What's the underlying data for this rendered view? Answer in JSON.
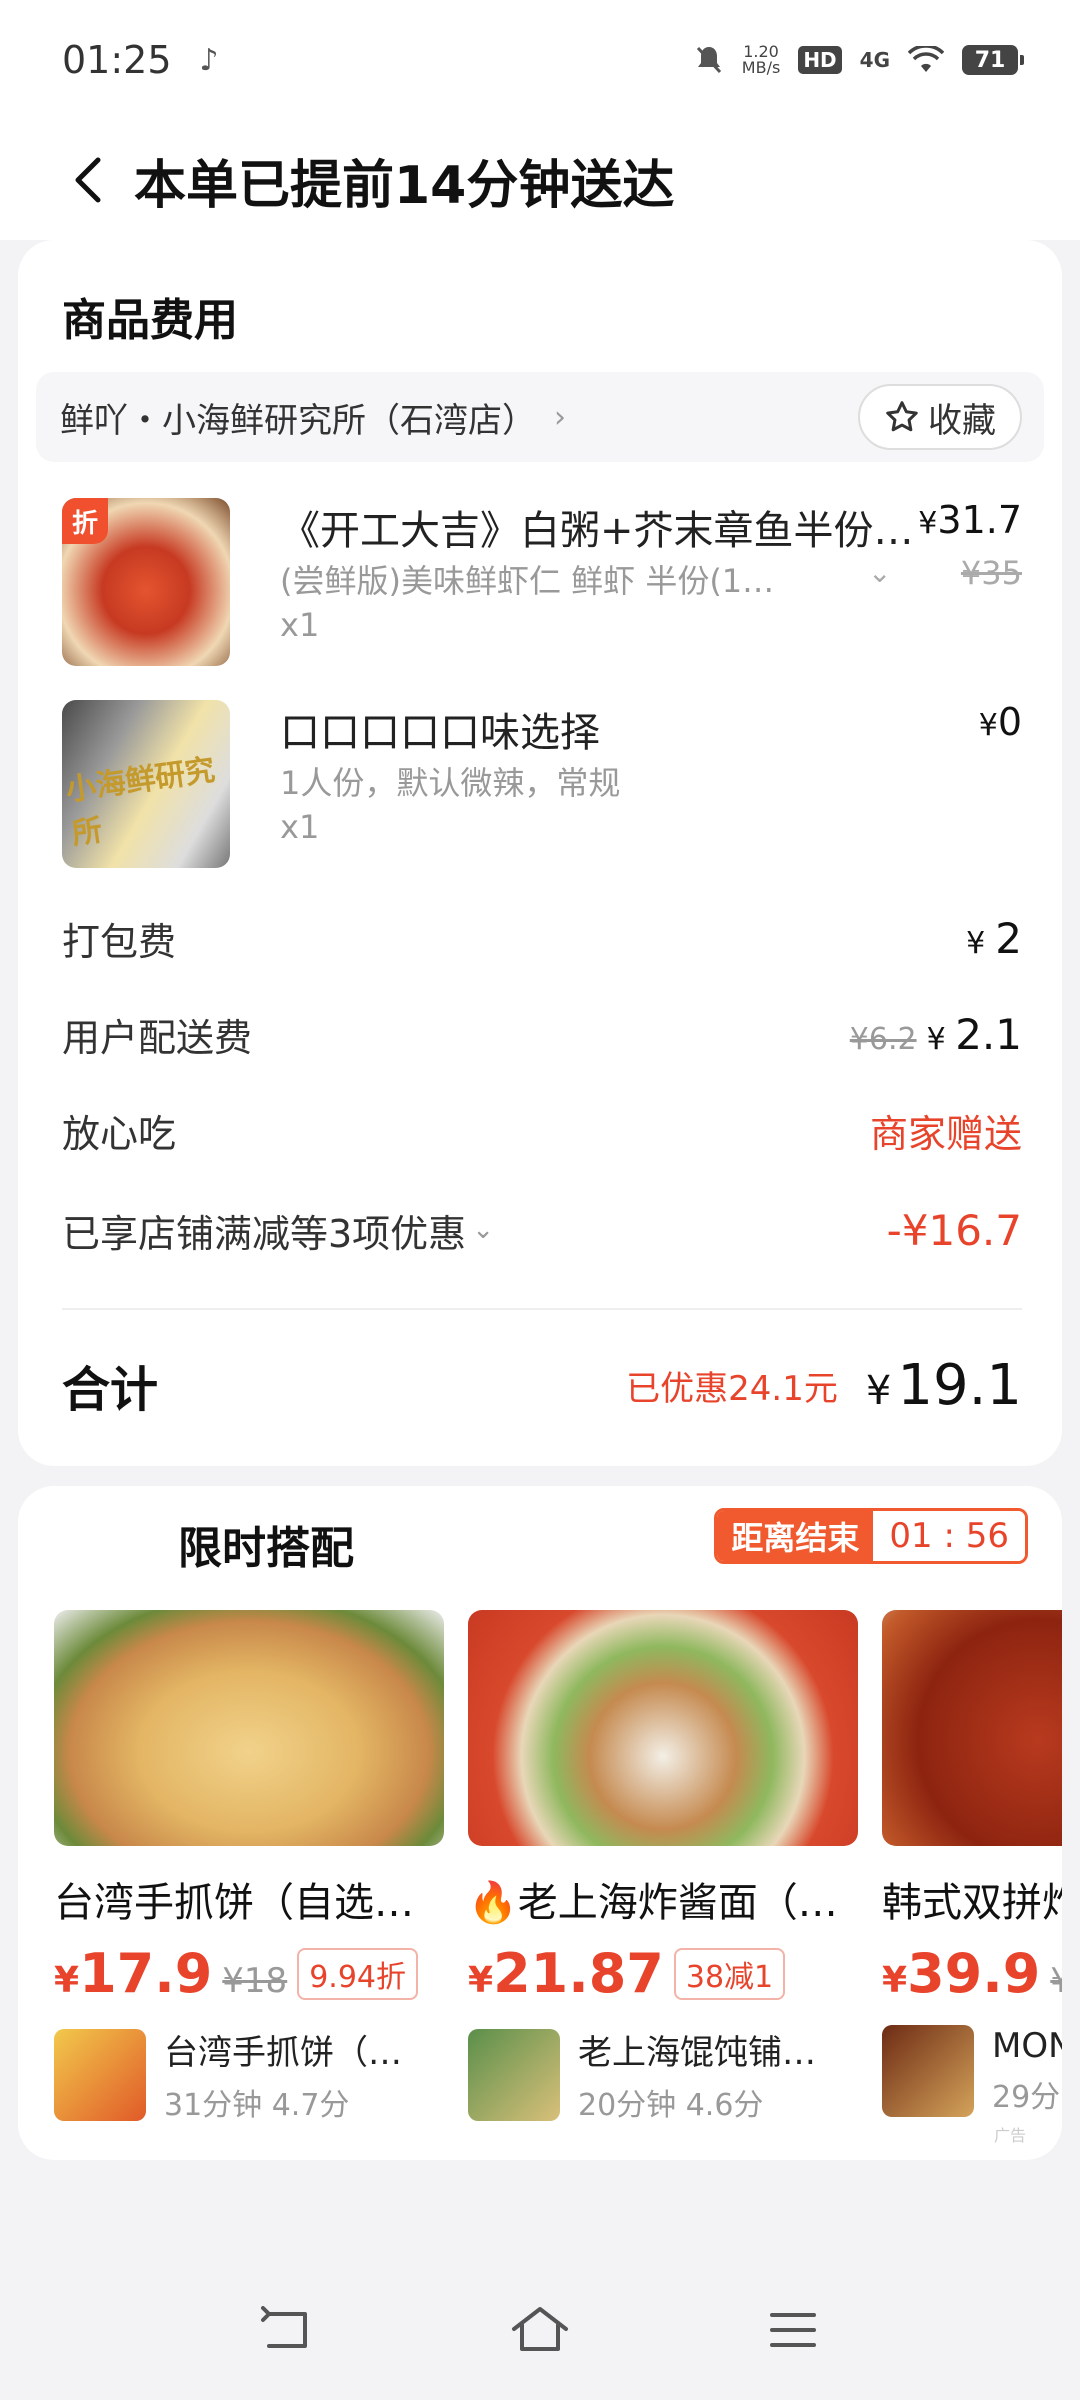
{
  "status_bar": {
    "time": "01:25",
    "speed_top": "1.20",
    "speed_unit": "MB/s",
    "hd": "HD",
    "network": "4G",
    "battery": "71"
  },
  "header": {
    "title": "本单已提前14分钟送达"
  },
  "order": {
    "section_title": "商品费用",
    "store_name": "鲜吖・小海鲜研究所（石湾店）",
    "favorite_label": "收藏",
    "items": [
      {
        "name": "《开工大吉》白粥+芥末章鱼半份+…",
        "desc": "(尝鲜版)美味鲜虾仁  鲜虾  半份(1…",
        "qty": "x1",
        "price": "31.7",
        "original_price": "¥35",
        "tag": "折"
      },
      {
        "name": "口口口口口味选择",
        "desc": "1人份，默认微辣，常规",
        "qty": "x1",
        "price": "0",
        "thumb_text": "小海鲜研究所"
      }
    ],
    "packing_fee": {
      "label": "打包费",
      "value": "2"
    },
    "delivery_fee": {
      "label": "用户配送费",
      "original": "¥6.2",
      "value": "2.1"
    },
    "worry_free": {
      "label": "放心吃",
      "value": "商家赠送"
    },
    "discounts": {
      "label": "已享店铺满减等3项优惠",
      "value": "-¥16.7"
    },
    "total": {
      "label": "合计",
      "saved": "已优惠24.1元",
      "value": "19.1"
    }
  },
  "combo": {
    "title": "限时搭配",
    "countdown_label": "距离结束",
    "countdown_time": "01 : 56",
    "ad_label": "广告",
    "products": [
      {
        "name": "台湾手抓饼（自选…",
        "price": "17.9",
        "original": "¥18",
        "tag": "9.94折",
        "shop_name": "台湾手抓饼（…",
        "shop_meta": "31分钟  4.7分"
      },
      {
        "name": "🔥老上海炸酱面（…",
        "price": "21.87",
        "original": "",
        "tag": "38减1",
        "shop_name": "老上海馄饨铺…",
        "shop_meta": "20分钟  4.6分"
      },
      {
        "name": "韩式双拼炸",
        "price": "39.9",
        "original": "¥",
        "tag": "",
        "shop_name": "MON",
        "shop_meta": "29分"
      }
    ]
  },
  "colors": {
    "accent_red": "#e8442c",
    "countdown_orange": "#f05a2e"
  },
  "icons": [
    "back-arrow-icon",
    "star-icon",
    "chevron-right-icon",
    "chevron-down-icon",
    "nav-back-icon",
    "nav-home-icon",
    "nav-menu-icon"
  ]
}
